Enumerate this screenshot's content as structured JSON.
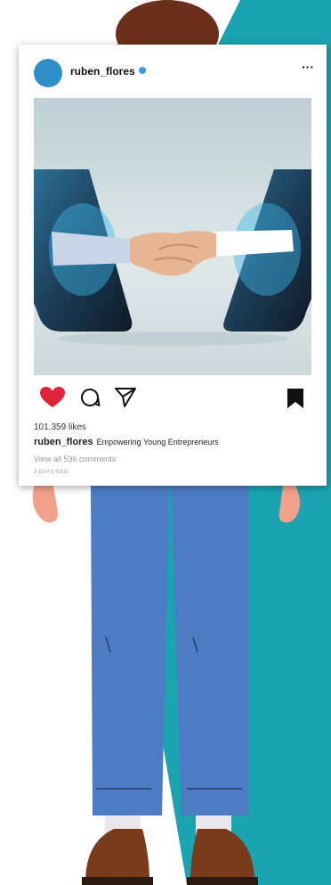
{
  "post": {
    "username": "ruben_flores",
    "likes": "101.359 likes",
    "caption_user": "ruben_flores",
    "caption_text": "Empowering Young Entrepreneurs",
    "comments_link": "View all 536 comments",
    "timestamp": "3 DAYS AGO",
    "more_label": "···"
  },
  "icons": {
    "like": "heart-icon",
    "comment": "comment-icon",
    "share": "send-icon",
    "save": "bookmark-icon",
    "verified": "verified-badge-icon"
  },
  "colors": {
    "teal_background": "#1aa3b0",
    "avatar": "#2f8fc8",
    "heart": "#e0243a",
    "pants": "#4e7cc4",
    "hair": "#6b2f1c",
    "skin": "#f2a28a",
    "shoes": "#7a3a1c"
  }
}
